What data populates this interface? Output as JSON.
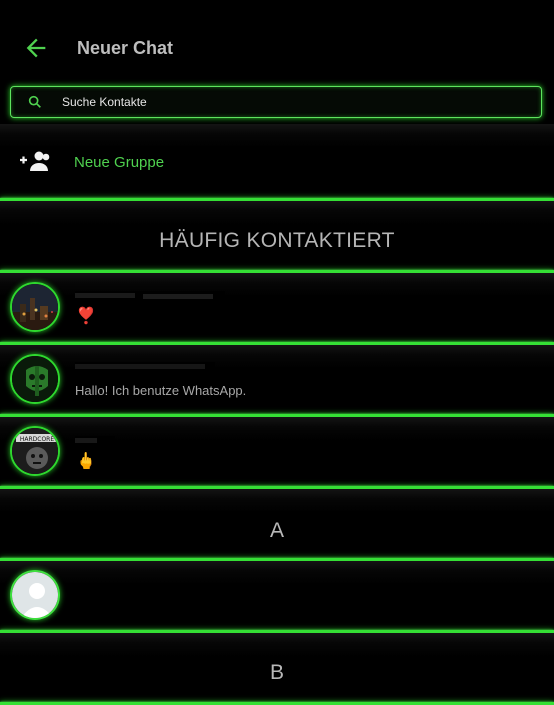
{
  "header": {
    "title": "Neuer Chat",
    "back_icon": "arrow-left-icon"
  },
  "search": {
    "placeholder": "Suche Kontakte",
    "icon": "search-icon"
  },
  "new_group": {
    "label": "Neue Gruppe",
    "icon": "group-add-icon"
  },
  "frequent": {
    "heading": "HÄUFIG KONTAKTIERT"
  },
  "contacts_frequent": [
    {
      "name": "",
      "status": "❣️",
      "avatar": "city-night-photo"
    },
    {
      "name": "",
      "status": "Hallo! Ich benutze WhatsApp.",
      "avatar": "green-skull-avatar"
    },
    {
      "name": "",
      "status": "🖕",
      "avatar": "hardcore-logo-avatar"
    }
  ],
  "sections": [
    {
      "letter": "A",
      "contacts": [
        {
          "name": "",
          "avatar": "default-person-avatar"
        }
      ]
    },
    {
      "letter": "B"
    }
  ],
  "colors": {
    "accent": "#35e035",
    "background": "#000000",
    "text": "#bdbdbd"
  }
}
